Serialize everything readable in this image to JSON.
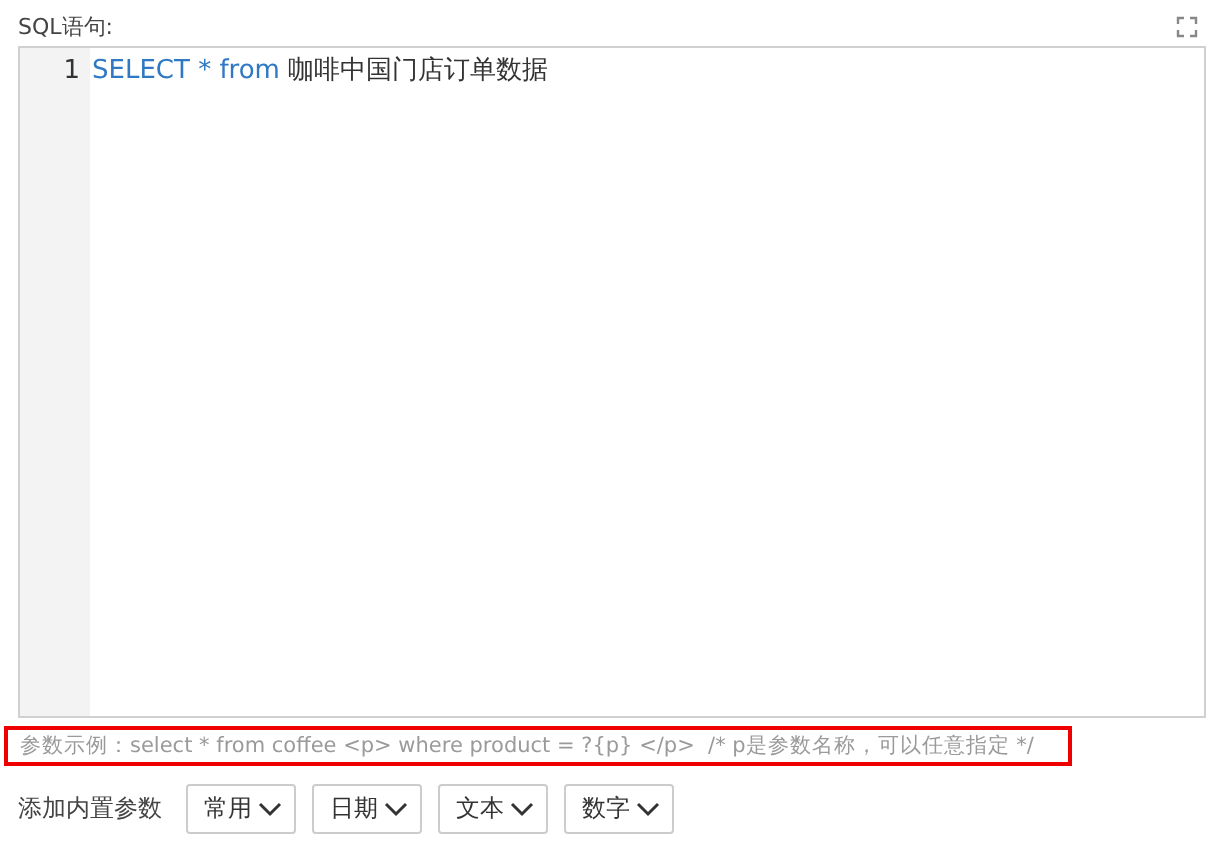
{
  "sql_label": "SQL语句:",
  "editor": {
    "lines": [
      {
        "number": "1",
        "tokens": [
          {
            "kind": "keyword",
            "text": "SELECT * from"
          },
          {
            "kind": "plain",
            "text": "咖啡中国门店订单数据"
          }
        ]
      }
    ]
  },
  "hint": {
    "text": "参数示例：select * from coffee <p> where product = ?{p} </p>  /* p是参数名称，可以任意指定 */",
    "highlighted": true
  },
  "param_label": "添加内置参数",
  "param_buttons": [
    {
      "label": "常用"
    },
    {
      "label": "日期"
    },
    {
      "label": "文本"
    },
    {
      "label": "数字"
    }
  ]
}
